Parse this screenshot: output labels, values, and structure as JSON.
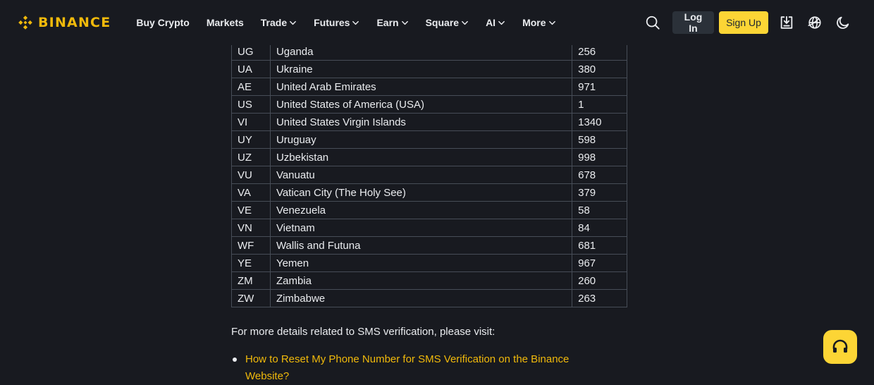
{
  "header": {
    "logo_text": "BINANCE",
    "nav": [
      {
        "label": "Buy Crypto",
        "dropdown": false
      },
      {
        "label": "Markets",
        "dropdown": false
      },
      {
        "label": "Trade",
        "dropdown": true
      },
      {
        "label": "Futures",
        "dropdown": true
      },
      {
        "label": "Earn",
        "dropdown": true
      },
      {
        "label": "Square",
        "dropdown": true
      },
      {
        "label": "AI",
        "dropdown": true
      },
      {
        "label": "More",
        "dropdown": true
      }
    ],
    "login_label": "Log In",
    "signup_label": "Sign Up",
    "icons": [
      "search-icon",
      "download-icon",
      "globe-icon",
      "moon-icon"
    ]
  },
  "table": {
    "rows": [
      [
        "UG",
        "Uganda",
        "256"
      ],
      [
        "UA",
        "Ukraine",
        "380"
      ],
      [
        "AE",
        "United Arab Emirates",
        "971"
      ],
      [
        "US",
        "United States of America (USA)",
        "1"
      ],
      [
        "VI",
        "United States Virgin Islands",
        "1340"
      ],
      [
        "UY",
        "Uruguay",
        "598"
      ],
      [
        "UZ",
        "Uzbekistan",
        "998"
      ],
      [
        "VU",
        "Vanuatu",
        "678"
      ],
      [
        "VA",
        "Vatican City (The Holy See)",
        "379"
      ],
      [
        "VE",
        "Venezuela",
        "58"
      ],
      [
        "VN",
        "Vietnam",
        "84"
      ],
      [
        "WF",
        "Wallis and Futuna",
        "681"
      ],
      [
        "YE",
        "Yemen",
        "967"
      ],
      [
        "ZM",
        "Zambia",
        "260"
      ],
      [
        "ZW",
        "Zimbabwe",
        "263"
      ]
    ]
  },
  "body": {
    "paragraph": "For more details related to SMS verification, please visit:",
    "links": [
      "How to Reset My Phone Number for SMS Verification on the Binance Website?"
    ]
  },
  "colors": {
    "background": "#181a20",
    "brand_yellow": "#f0b90b",
    "button_yellow": "#fcd535",
    "login_bg": "#2b3139",
    "text": "#eaecef",
    "border": "#474d57"
  },
  "support": {
    "icon": "headset-icon"
  }
}
